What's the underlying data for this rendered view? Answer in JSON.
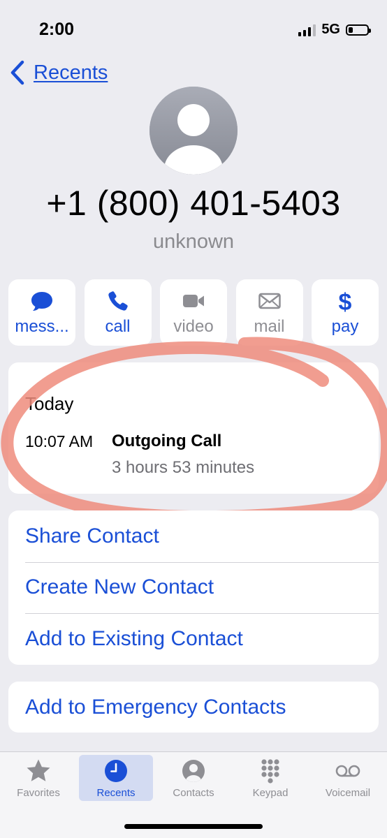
{
  "status_bar": {
    "time": "2:00",
    "network": "5G",
    "battery_level_percent": 25
  },
  "nav": {
    "back_label": "Recents"
  },
  "contact": {
    "phone_number": "+1 (800) 401-5403",
    "subtitle": "unknown"
  },
  "actions": [
    {
      "label": "mess...",
      "icon": "message-bubble-icon",
      "enabled": true
    },
    {
      "label": "call",
      "icon": "phone-icon",
      "enabled": true
    },
    {
      "label": "video",
      "icon": "video-camera-icon",
      "enabled": false
    },
    {
      "label": "mail",
      "icon": "envelope-icon",
      "enabled": false
    },
    {
      "label": "pay",
      "icon": "dollar-icon",
      "enabled": true
    }
  ],
  "recent_call": {
    "day": "Today",
    "time": "10:07 AM",
    "type": "Outgoing Call",
    "duration": "3 hours 53 minutes"
  },
  "options": [
    {
      "label": "Share Contact"
    },
    {
      "label": "Create New Contact"
    },
    {
      "label": "Add to Existing Contact"
    }
  ],
  "emergency_option": {
    "label": "Add to Emergency Contacts"
  },
  "tab_bar": {
    "tabs": [
      {
        "label": "Favorites",
        "icon": "star-icon"
      },
      {
        "label": "Recents",
        "icon": "clock-icon"
      },
      {
        "label": "Contacts",
        "icon": "person-circle-icon"
      },
      {
        "label": "Keypad",
        "icon": "keypad-icon"
      },
      {
        "label": "Voicemail",
        "icon": "voicemail-icon"
      }
    ],
    "active": "Recents"
  },
  "colors": {
    "accent": "#1a4fd6",
    "background": "#ececf1",
    "annotation": "#ef8c7c"
  }
}
